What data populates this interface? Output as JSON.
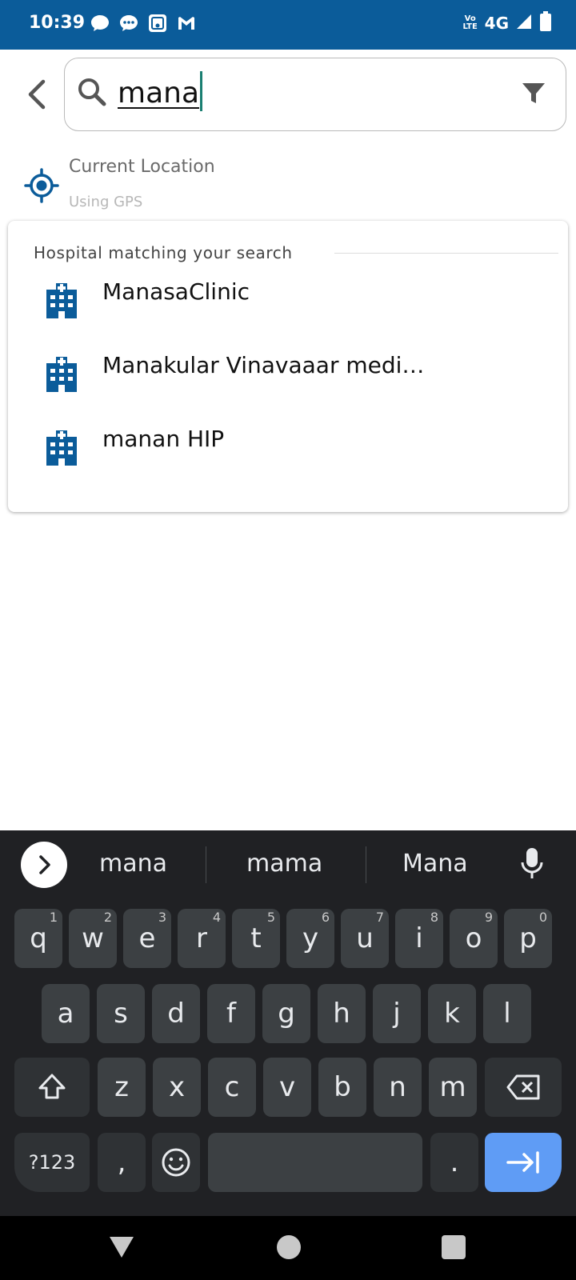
{
  "status_bar": {
    "time": "10:39",
    "network": "4G",
    "volte": "Vo LTE",
    "left_icons": [
      "chat-bubble-icon",
      "message-dots-icon",
      "gallery-icon",
      "gmail-icon"
    ],
    "right_icons": [
      "volte-icon",
      "signal-icon",
      "battery-icon"
    ],
    "bg_color": "#0B5C9A"
  },
  "search": {
    "value": "mana",
    "back_icon": "chevron-left-icon",
    "search_icon": "search-icon",
    "filter_icon": "filter-icon"
  },
  "current_location": {
    "title": "Current Location",
    "subtitle": "Using GPS",
    "icon": "gps-target-icon",
    "accent_color": "#0B5C9A"
  },
  "results": {
    "header": "Hospital matching your search",
    "items": [
      {
        "label": "ManasaClinic",
        "icon": "hospital-icon"
      },
      {
        "label": "Manakular Vinavaaar medi…",
        "icon": "hospital-icon"
      },
      {
        "label": "manan HIP",
        "icon": "hospital-icon"
      }
    ]
  },
  "keyboard": {
    "suggestions": [
      "mana",
      "mama",
      "Mana"
    ],
    "row1": [
      {
        "key": "q",
        "hint": "1"
      },
      {
        "key": "w",
        "hint": "2"
      },
      {
        "key": "e",
        "hint": "3"
      },
      {
        "key": "r",
        "hint": "4"
      },
      {
        "key": "t",
        "hint": "5"
      },
      {
        "key": "y",
        "hint": "6"
      },
      {
        "key": "u",
        "hint": "7"
      },
      {
        "key": "i",
        "hint": "8"
      },
      {
        "key": "o",
        "hint": "9"
      },
      {
        "key": "p",
        "hint": "0"
      }
    ],
    "row2": [
      "a",
      "s",
      "d",
      "f",
      "g",
      "h",
      "j",
      "k",
      "l"
    ],
    "row3": [
      "z",
      "x",
      "c",
      "v",
      "b",
      "n",
      "m"
    ],
    "symbols_label": "?123",
    "comma_label": ",",
    "period_label": ".",
    "enter_color": "#5f9cf5"
  }
}
